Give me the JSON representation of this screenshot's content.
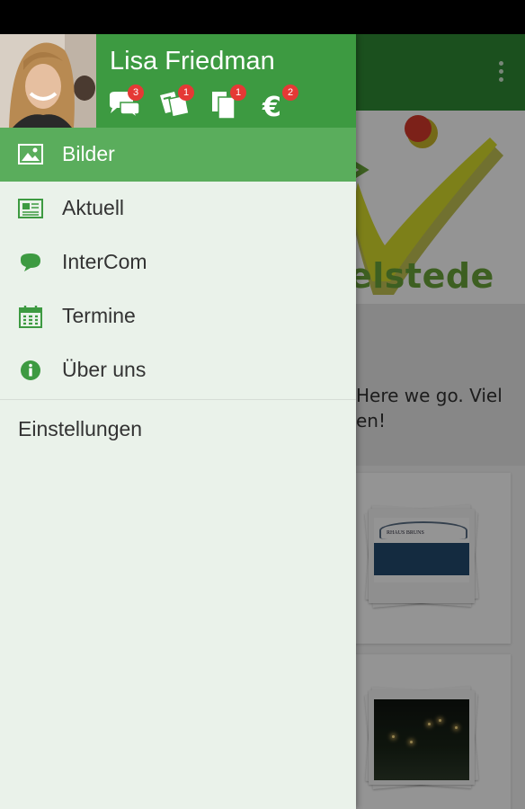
{
  "user": {
    "name": "Lisa Friedman"
  },
  "badges": [
    {
      "icon": "chat-bubbles-icon",
      "count": "3"
    },
    {
      "icon": "tickets-icon",
      "count": "1"
    },
    {
      "icon": "documents-icon",
      "count": "1"
    },
    {
      "icon": "euro-icon",
      "count": "2"
    }
  ],
  "menu": [
    {
      "label": "Bilder",
      "icon": "image-icon",
      "active": true
    },
    {
      "label": "Aktuell",
      "icon": "newspaper-icon",
      "active": false
    },
    {
      "label": "InterCom",
      "icon": "chat-bubble-icon",
      "active": false
    },
    {
      "label": "Termine",
      "icon": "calendar-icon",
      "active": false
    },
    {
      "label": "Über uns",
      "icon": "info-icon",
      "active": false
    }
  ],
  "settings": {
    "label": "Einstellungen"
  },
  "background": {
    "logo_text": "elstede",
    "welcome_line1": "Here we go. Viel",
    "welcome_line2": "en!",
    "card1_caption": "RHAUS BRUNS"
  },
  "colors": {
    "toolbar": "#2f8a34",
    "drawer_header": "#3d9a41",
    "active_item": "#5aad5c",
    "drawer_bg": "#eaf2ea",
    "badge": "#e53935",
    "icon_green": "#3d9a41"
  }
}
